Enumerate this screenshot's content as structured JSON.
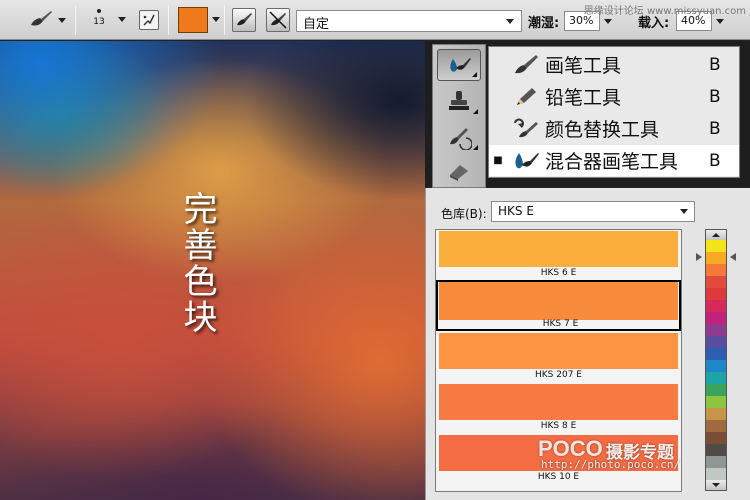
{
  "options_bar": {
    "brush_size": "13",
    "current_color": "#ef7a1e",
    "preset": "自定",
    "wet_label": "潮湿:",
    "wet_value": "30%",
    "load_label": "载入:",
    "load_value": "40%",
    "watermark": "思缘设计论坛 www.missyuan.com"
  },
  "canvas": {
    "title": "完善色块"
  },
  "tool_flyout": {
    "items": [
      {
        "label": "画笔工具",
        "shortcut": "B",
        "selected": false
      },
      {
        "label": "铅笔工具",
        "shortcut": "B",
        "selected": false
      },
      {
        "label": "颜色替换工具",
        "shortcut": "B",
        "selected": false
      },
      {
        "label": "混合器画笔工具",
        "shortcut": "B",
        "selected": true
      }
    ]
  },
  "color_library": {
    "label": "色库(B):",
    "selected_book": "HKS E",
    "swatches": [
      {
        "name": "HKS 6 E",
        "color": "#fcae3c",
        "selected": false
      },
      {
        "name": "HKS 7 E",
        "color": "#f98b3c",
        "selected": true
      },
      {
        "name": "HKS 207 E",
        "color": "#fc9442",
        "selected": false
      },
      {
        "name": "HKS 8 E",
        "color": "#f77a42",
        "selected": false
      },
      {
        "name": "HKS 10 E",
        "color": "#f46c44",
        "selected": false
      }
    ],
    "ramp_colors": [
      "#f2e418",
      "#f7a825",
      "#f57a37",
      "#e24a3c",
      "#dd3a3d",
      "#d82a5a",
      "#c2237a",
      "#8f3b8f",
      "#5a4da0",
      "#2d5fb0",
      "#1f86c9",
      "#1ea3a6",
      "#3aa45a",
      "#8cc63e",
      "#c89548",
      "#a06a3c",
      "#7a4e34",
      "#4f4b48",
      "#8e9794",
      "#c3c7c4"
    ]
  },
  "watermark": {
    "brand": "POCO",
    "brand_cn": "摄影专题",
    "url": "http://photo.poco.cn/"
  }
}
